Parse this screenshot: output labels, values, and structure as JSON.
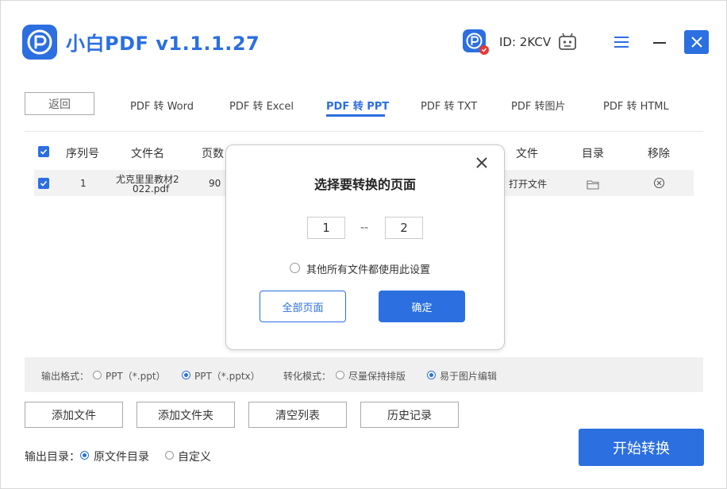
{
  "app": {
    "title": "小白PDF v1.1.1.27",
    "user_id": "ID: 2KCV",
    "accent": "#2b6fe0"
  },
  "tabs": {
    "back_label": "返回",
    "items": [
      {
        "label": "PDF 转 Word"
      },
      {
        "label": "PDF 转 Excel"
      },
      {
        "label": "PDF 转 PPT",
        "active": true
      },
      {
        "label": "PDF 转 TXT"
      },
      {
        "label": "PDF 转图片"
      },
      {
        "label": "PDF 转 HTML"
      }
    ]
  },
  "table": {
    "headers": {
      "index": "序列号",
      "filename": "文件名",
      "pages": "页数",
      "file": "文件",
      "dir": "目录",
      "remove": "移除"
    },
    "rows": [
      {
        "index": "1",
        "filename_line1": "尤克里里教材2",
        "filename_line2": "022.pdf",
        "pages": "90",
        "open": "打开文件"
      }
    ]
  },
  "dialog": {
    "title": "选择要转换的页面",
    "from_page": "1",
    "separator": "--",
    "to_page": "2",
    "apply_all_label": "其他所有文件都使用此设置",
    "all_pages_label": "全部页面",
    "confirm_label": "确定"
  },
  "options": {
    "format_label": "输出格式：",
    "format_ppt": "PPT（*.ppt）",
    "format_pptx": "PPT（*.pptx）",
    "mode_label": "转化模式：",
    "mode_layout": "尽量保持排版",
    "mode_image": "易于图片编辑"
  },
  "actions": {
    "add_file": "添加文件",
    "add_folder": "添加文件夹",
    "clear_list": "清空列表",
    "history": "历史记录",
    "start": "开始转换"
  },
  "output": {
    "label": "输出目录：",
    "original": "原文件目录",
    "custom": "自定义"
  }
}
